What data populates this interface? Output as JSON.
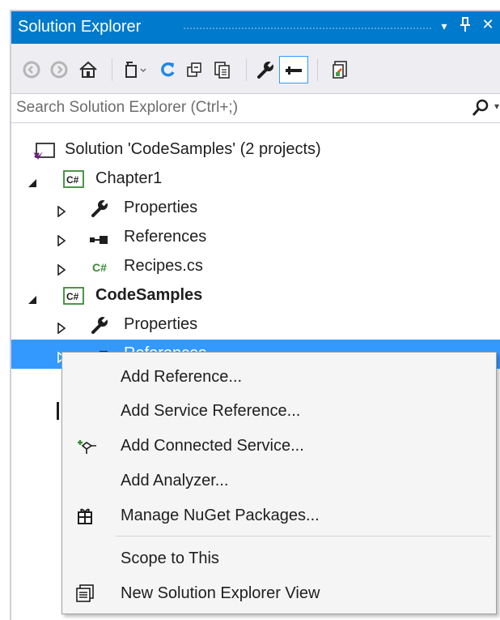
{
  "window": {
    "title": "Solution Explorer",
    "buttons": [
      "▾",
      "ⵖ",
      "✕"
    ]
  },
  "toolbar": {
    "tools": [
      "back-icon",
      "forward-icon",
      "home-icon",
      "pending-changes-icon",
      "refresh-icon",
      "collapse-all-icon",
      "show-all-files-icon",
      "properties-wrench-icon",
      "preview-selected-icon",
      "view-class-diagram-icon"
    ]
  },
  "search": {
    "placeholder": "Search Solution Explorer (Ctrl+;)"
  },
  "tree": {
    "solution": "Solution 'CodeSamples' (2 projects)",
    "project1": {
      "name": "Chapter1",
      "badge": "C#",
      "items": [
        "Properties",
        "References",
        "Recipes.cs"
      ]
    },
    "project2": {
      "name": "CodeSamples",
      "badge": "C#",
      "items": [
        "Properties",
        "References"
      ]
    }
  },
  "context_menu": {
    "items": [
      "Add Reference...",
      "Add Service Reference...",
      "Add Connected Service...",
      "Add Analyzer...",
      "Manage NuGet Packages...",
      "Scope to This",
      "New Solution Explorer View"
    ]
  },
  "colors": {
    "accent": "#007acc",
    "selection": "#3399ff",
    "csharp_green": "#388a34"
  }
}
